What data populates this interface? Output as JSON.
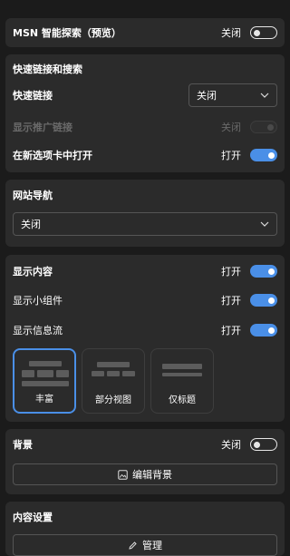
{
  "msn": {
    "label": "MSN 智能探索（预览）",
    "state": "关闭"
  },
  "quick_links": {
    "title": "快速链接和搜索",
    "links_label": "快速链接",
    "links_select": "关闭",
    "promoted_label": "显示推广链接",
    "promoted_state": "关闭",
    "newtab_label": "在新选项卡中打开",
    "newtab_state": "打开"
  },
  "site_nav": {
    "title": "网站导航",
    "select": "关闭"
  },
  "content": {
    "show_content_label": "显示内容",
    "show_content_state": "打开",
    "widgets_label": "显示小组件",
    "widgets_state": "打开",
    "feed_label": "显示信息流",
    "feed_state": "打开",
    "layouts": [
      "丰富",
      "部分视图",
      "仅标题"
    ]
  },
  "background": {
    "label": "背景",
    "state": "关闭",
    "edit_button": "编辑背景"
  },
  "content_settings": {
    "title": "内容设置",
    "manage_button": "管理"
  },
  "colors": {
    "accent": "#4a8fe7",
    "panel": "#2b2b2b",
    "page": "#1b1b1b"
  }
}
